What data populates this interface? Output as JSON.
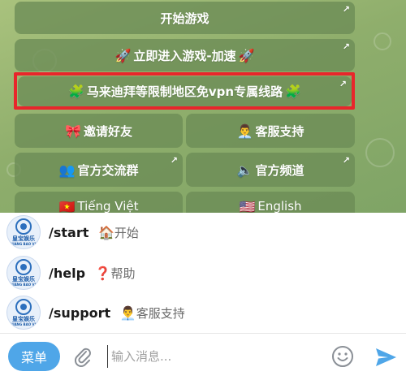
{
  "keyboard": {
    "start_game": {
      "label": "开始游戏"
    },
    "enter_game": {
      "icon_left": "🚀",
      "label": "立即进入游戏-加速",
      "icon_right": "🚀"
    },
    "vpn_line": {
      "icon_left": "🧩",
      "label": "马来迪拜等限制地区免vpn专属线路",
      "icon_right": "🧩"
    },
    "invite": {
      "icon": "🎀",
      "label": "邀请好友"
    },
    "support": {
      "icon": "👨‍💼",
      "label": "客服支持"
    },
    "group": {
      "icon": "👥",
      "label": "官方交流群"
    },
    "channel": {
      "icon": "🔈",
      "label": "官方频道"
    },
    "vietnamese": {
      "icon": "🇻🇳",
      "label": "Tiếng Việt"
    },
    "english": {
      "icon": "🇺🇸",
      "label": "English"
    },
    "link_arrow": "↗",
    "highlight_color": "#e8262b"
  },
  "commands": [
    {
      "command": "/start",
      "emoji": "🏠",
      "description": "开始"
    },
    {
      "command": "/help",
      "emoji": "❓",
      "description": "帮助"
    },
    {
      "command": "/support",
      "emoji": "👨‍💼",
      "description": "客服支持"
    }
  ],
  "bot_avatar": {
    "line1": "皇宝娱乐",
    "line2": "HUANG BAO VIP"
  },
  "input_bar": {
    "menu_label": "菜单",
    "placeholder": "输入消息...",
    "accent_color": "#4fa6e8"
  }
}
